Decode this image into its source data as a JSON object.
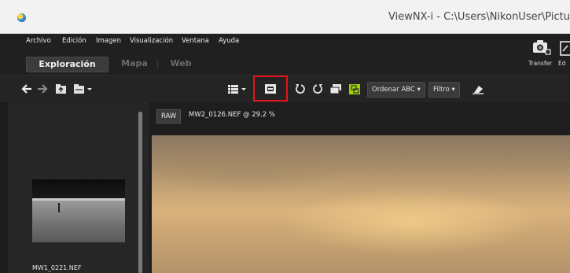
{
  "window": {
    "title": "ViewNX-i - C:\\Users\\NikonUser\\Pictu"
  },
  "menu": [
    "Archivo",
    "Edición",
    "Imagen",
    "Visualización",
    "Ventana",
    "Ayuda"
  ],
  "tabs": [
    {
      "label": "Exploración",
      "active": true
    },
    {
      "label": "Mapa",
      "active": false
    },
    {
      "label": "Web",
      "active": false
    }
  ],
  "top_tools": {
    "transfer_label": "Transfer",
    "edit_label": "Ed"
  },
  "toolbar": {
    "sort_label": "Ordenar ABC",
    "filter_label": "Filtro"
  },
  "viewer": {
    "raw_badge": "RAW",
    "file_info": "MW2_0126.NEF @ 29.2 %"
  },
  "sidebar": {
    "thumbnail_label": "MW1_0221.NEF"
  },
  "colors": {
    "highlight": "#e6141b",
    "bg": "#202020",
    "accent_green": "#9fd400"
  }
}
